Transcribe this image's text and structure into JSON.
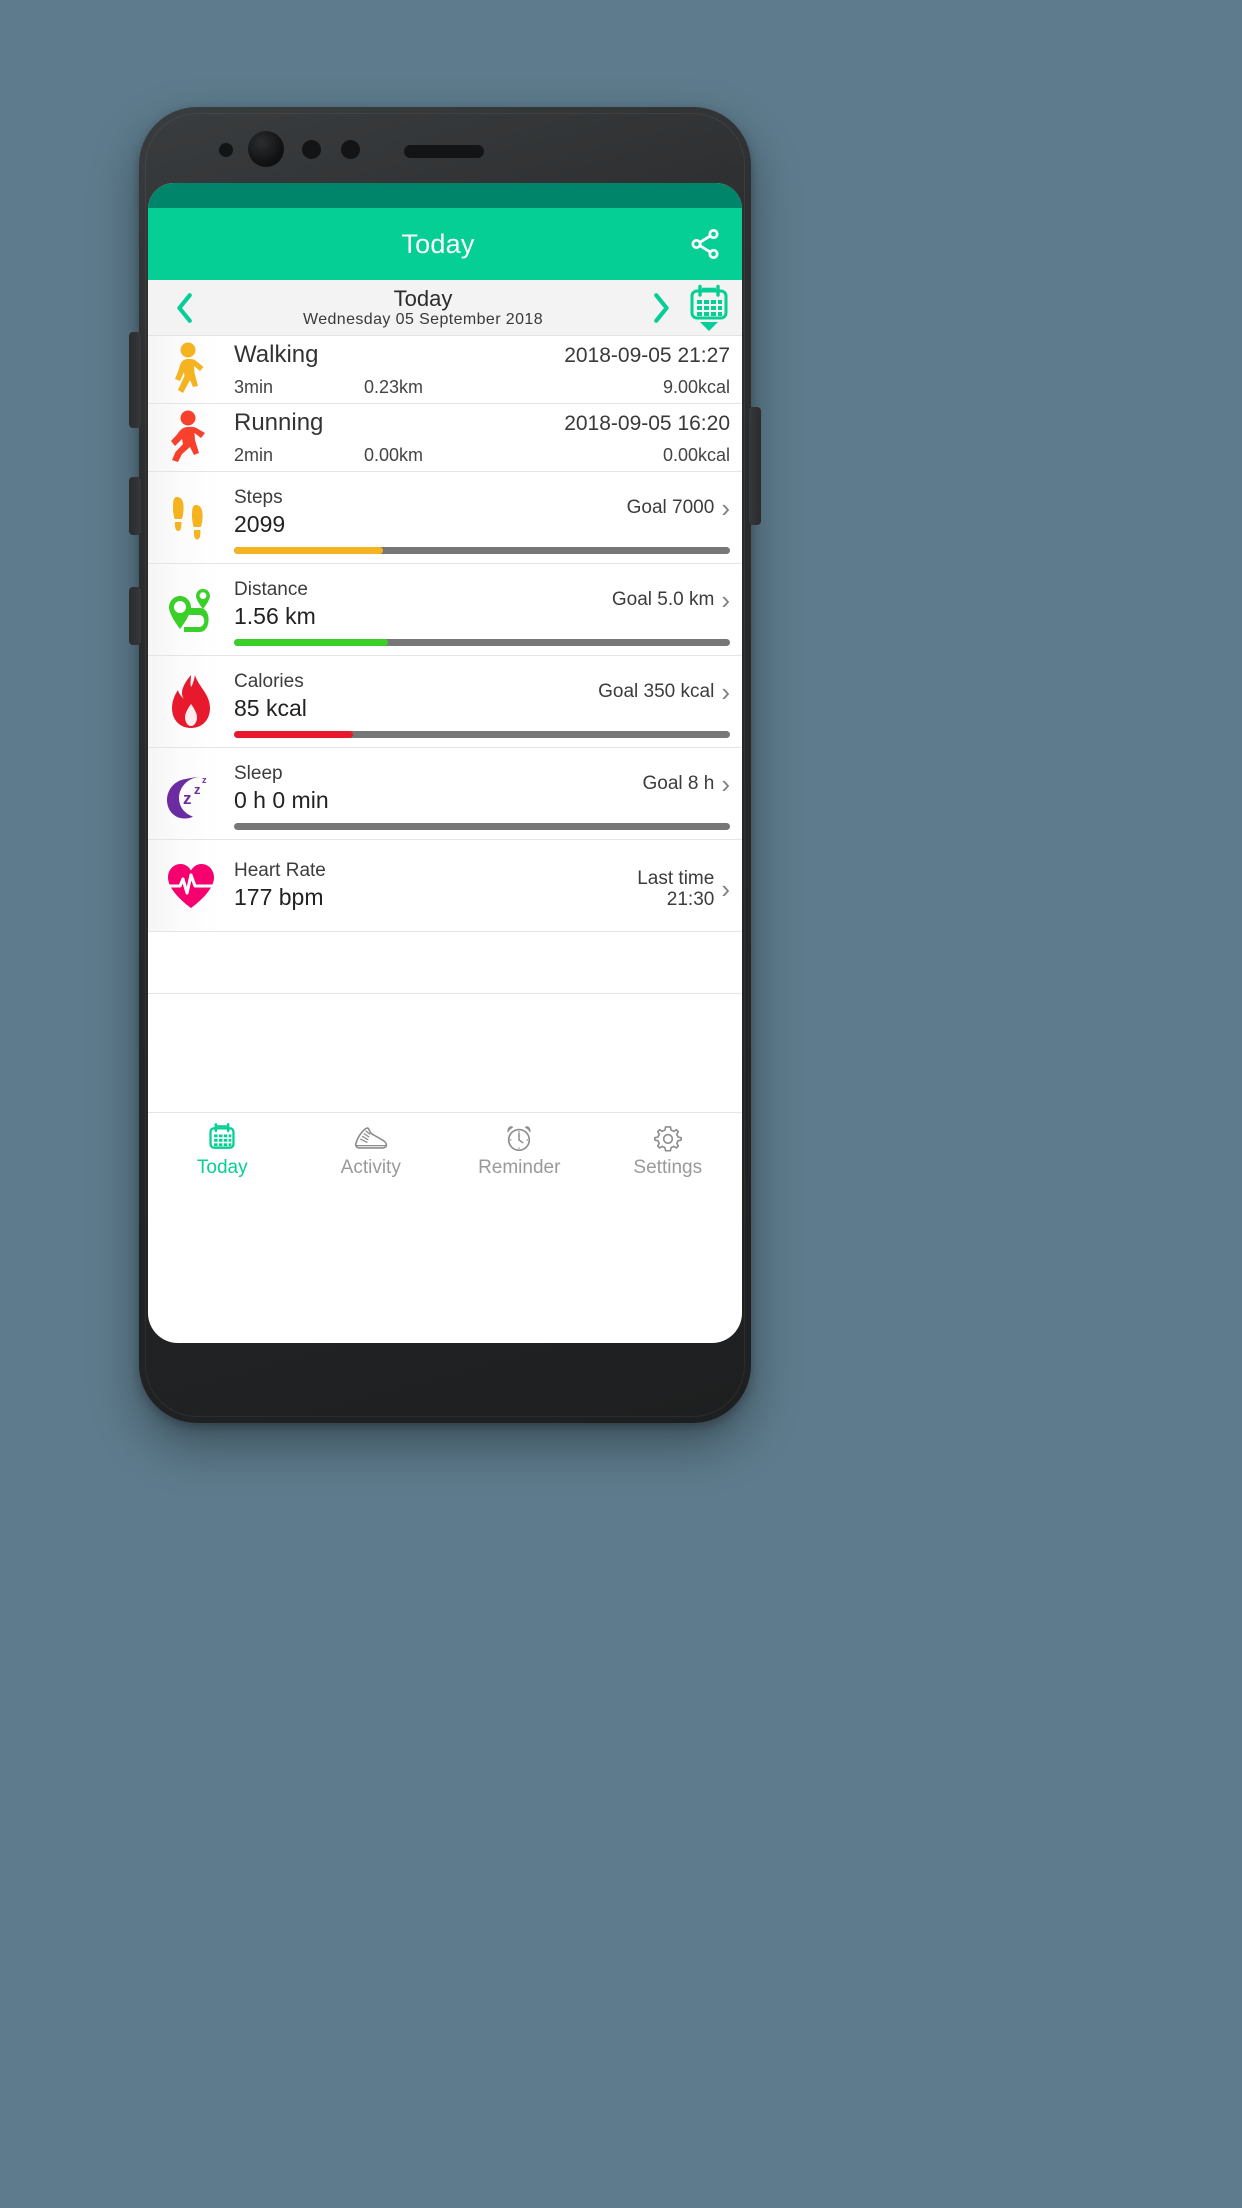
{
  "app": {
    "title": "Today",
    "share_icon": "share-icon",
    "accent_color": "#06cf95",
    "statusbar_color": "#00856a"
  },
  "datebar": {
    "prev_icon": "chevron-left-icon",
    "next_icon": "chevron-right-icon",
    "title": "Today",
    "subtitle": "Wednesday  05  September  2018",
    "calendar_icon": "calendar-dropdown-icon"
  },
  "workouts": [
    {
      "icon": "walking-icon",
      "icon_color": "#f5b320",
      "name": "Walking",
      "datetime": "2018-09-05 21:27",
      "duration": "3min",
      "distance": "0.23km",
      "calories": "9.00kcal"
    },
    {
      "icon": "running-icon",
      "icon_color": "#f7412d",
      "name": "Running",
      "datetime": "2018-09-05 16:20",
      "duration": "2min",
      "distance": "0.00km",
      "calories": "0.00kcal"
    }
  ],
  "metrics": [
    {
      "icon": "footprints-icon",
      "icon_color": "#f5b320",
      "label": "Steps",
      "value": "2099",
      "goal_line1": "Goal 7000",
      "goal_line2": "",
      "chevron": "chevron-right-icon",
      "progress_percent": 30,
      "bar_color": "#f5b320",
      "has_bar": true
    },
    {
      "icon": "route-pin-icon",
      "icon_color": "#3ad029",
      "label": "Distance",
      "value": "1.56 km",
      "goal_line1": "Goal 5.0 km",
      "goal_line2": "",
      "chevron": "chevron-right-icon",
      "progress_percent": 31,
      "bar_color": "#3ad029",
      "has_bar": true
    },
    {
      "icon": "flame-icon",
      "icon_color": "#e8192c",
      "label": "Calories",
      "value": "85 kcal",
      "goal_line1": "Goal 350 kcal",
      "goal_line2": "",
      "chevron": "chevron-right-icon",
      "progress_percent": 24,
      "bar_color": "#e8192c",
      "has_bar": true
    },
    {
      "icon": "moon-sleep-icon",
      "icon_color": "#6a2ca0",
      "label": "Sleep",
      "value": "0 h 0 min",
      "goal_line1": "Goal 8 h",
      "goal_line2": "",
      "chevron": "chevron-right-icon",
      "progress_percent": 0,
      "bar_color": "#777777",
      "has_bar": true
    },
    {
      "icon": "heart-pulse-icon",
      "icon_color": "#f5006e",
      "label": "Heart Rate",
      "value": "177 bpm",
      "goal_line1": "Last time",
      "goal_line2": "21:30",
      "chevron": "chevron-right-icon",
      "progress_percent": 0,
      "bar_color": "#777777",
      "has_bar": false
    }
  ],
  "bottomnav": {
    "items": [
      {
        "icon": "calendar-icon",
        "label": "Today",
        "active": true
      },
      {
        "icon": "shoe-icon",
        "label": "Activity",
        "active": false
      },
      {
        "icon": "alarm-clock-icon",
        "label": "Reminder",
        "active": false
      },
      {
        "icon": "gear-icon",
        "label": "Settings",
        "active": false
      }
    ],
    "active_color": "#06cf95",
    "inactive_color": "#9a9a9a"
  }
}
